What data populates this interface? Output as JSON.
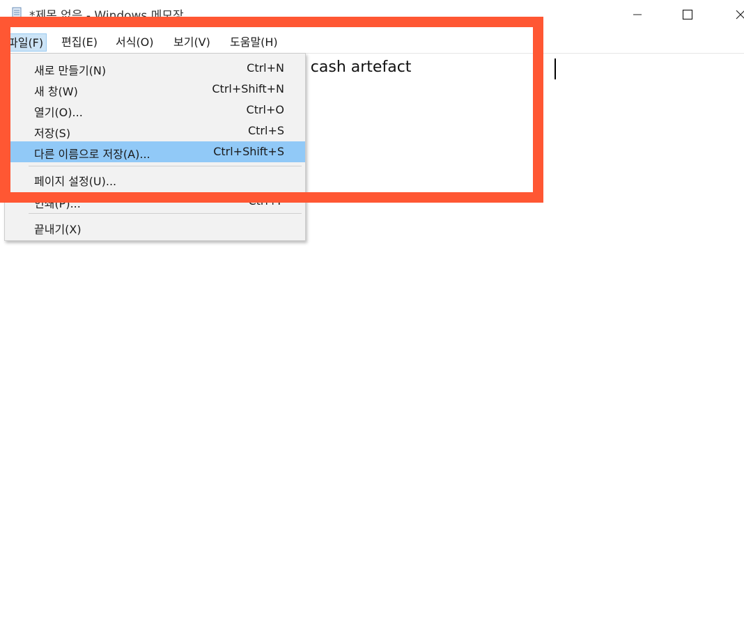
{
  "window": {
    "title": "*제목 없음 - Windows 메모장",
    "controls": {
      "minimize_icon": "minimize-icon",
      "maximize_icon": "maximize-icon",
      "close_icon": "close-icon"
    }
  },
  "menubar": {
    "items": [
      {
        "label": "파일(F)",
        "active": true
      },
      {
        "label": "편집(E)"
      },
      {
        "label": "서식(O)"
      },
      {
        "label": "보기(V)"
      },
      {
        "label": "도움말(H)"
      }
    ]
  },
  "file_menu": {
    "items": [
      {
        "label": "새로 만들기(N)",
        "shortcut": "Ctrl+N"
      },
      {
        "label": "새 창(W)",
        "shortcut": "Ctrl+Shift+N"
      },
      {
        "label": "열기(O)...",
        "shortcut": "Ctrl+O"
      },
      {
        "label": "저장(S)",
        "shortcut": "Ctrl+S"
      },
      {
        "label": "다른 이름으로 저장(A)...",
        "shortcut": "Ctrl+Shift+S",
        "highlighted": true
      },
      {
        "label": "페이지 설정(U)..."
      },
      {
        "label": "인쇄(P)...",
        "shortcut": "Ctrl+P"
      },
      {
        "label": "끝내기(X)"
      }
    ]
  },
  "editor": {
    "text": "e laugh dwarf bargain rathe receive cash artefact"
  },
  "annotation": {
    "color": "#ff5733"
  }
}
